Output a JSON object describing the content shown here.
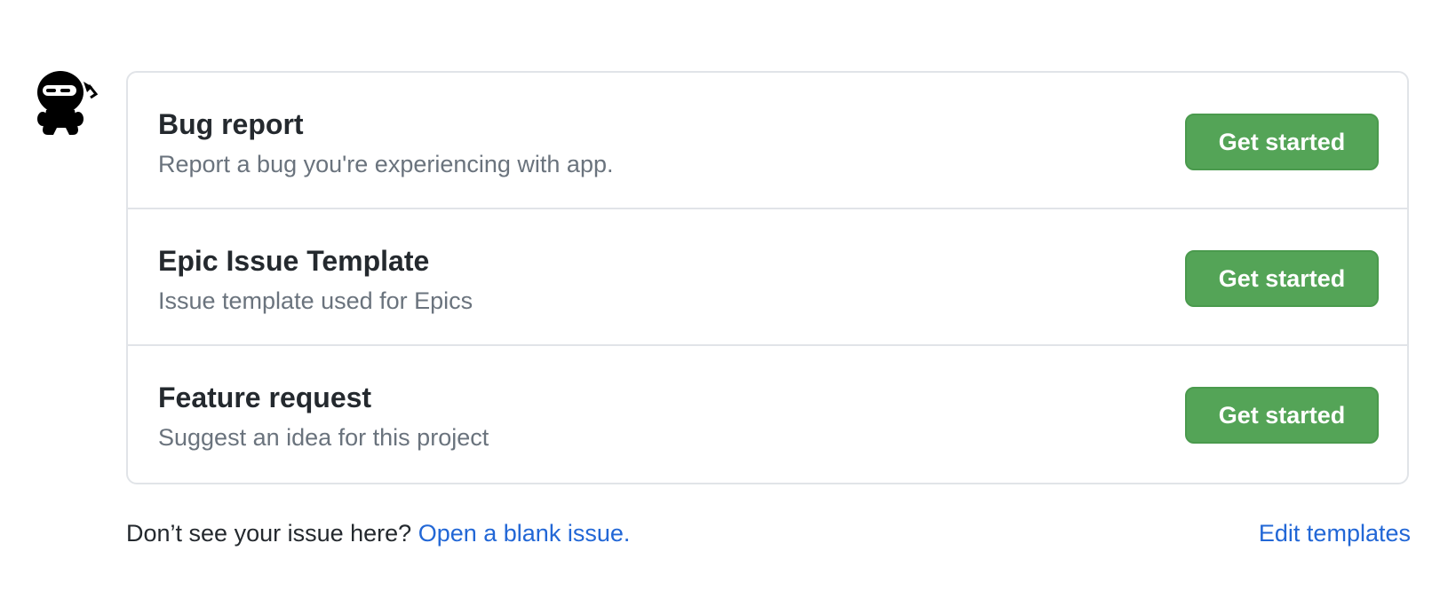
{
  "templates": [
    {
      "title": "Bug report",
      "description": "Report a bug you're experiencing with app.",
      "button_label": "Get started"
    },
    {
      "title": "Epic Issue Template",
      "description": "Issue template used for Epics",
      "button_label": "Get started"
    },
    {
      "title": "Feature request",
      "description": "Suggest an idea for this project",
      "button_label": "Get started"
    }
  ],
  "footer": {
    "prompt": "Don’t see your issue here?",
    "blank_issue_link": "Open a blank issue.",
    "edit_templates_link": "Edit templates"
  },
  "colors": {
    "button_bg": "#54a457",
    "link": "#2267d6",
    "muted_text": "#6a737d"
  },
  "icons": {
    "avatar": "ninja-avatar-icon"
  }
}
